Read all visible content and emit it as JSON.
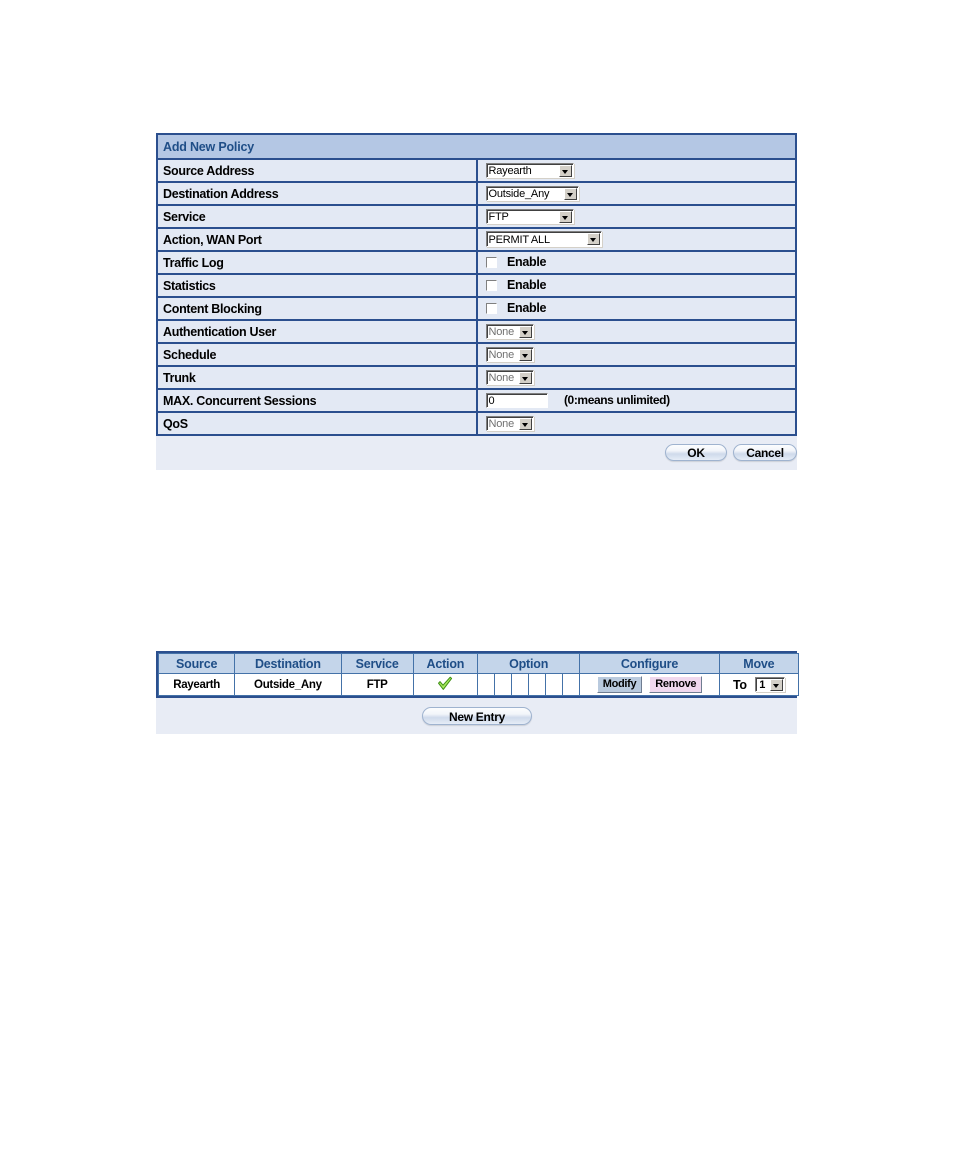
{
  "policy_form": {
    "title": "Add New Policy",
    "rows": [
      {
        "label": "Source Address",
        "type": "select",
        "value": "Rayearth",
        "width": "ws-w84",
        "dim": false
      },
      {
        "label": "Destination Address",
        "type": "select",
        "value": "Outside_Any",
        "width": "ws-w90",
        "dim": false
      },
      {
        "label": "Service",
        "type": "select",
        "value": "FTP",
        "width": "ws-w84",
        "dim": false
      },
      {
        "label": "Action, WAN Port",
        "type": "select",
        "value": "PERMIT ALL",
        "width": "ws-w110",
        "dim": false
      },
      {
        "label": "Traffic Log",
        "type": "checkbox",
        "value": "Enable",
        "checked": false
      },
      {
        "label": "Statistics",
        "type": "checkbox",
        "value": "Enable",
        "checked": false
      },
      {
        "label": "Content Blocking",
        "type": "checkbox",
        "value": "Enable",
        "checked": false
      },
      {
        "label": "Authentication User",
        "type": "select",
        "value": "None",
        "width": "ws-w46",
        "dim": true
      },
      {
        "label": "Schedule",
        "type": "select",
        "value": "None",
        "width": "ws-w46",
        "dim": true
      },
      {
        "label": "Trunk",
        "type": "select",
        "value": "None",
        "width": "ws-w46",
        "dim": true
      },
      {
        "label": "MAX. Concurrent Sessions",
        "type": "text",
        "value": "0",
        "hint": "(0:means unlimited)"
      },
      {
        "label": "QoS",
        "type": "select",
        "value": "None",
        "width": "ws-w46",
        "dim": true
      }
    ],
    "ok_label": "OK",
    "cancel_label": "Cancel"
  },
  "policy_list": {
    "headers": [
      "Source",
      "Destination",
      "Service",
      "Action",
      "Option",
      "Configure",
      "Move"
    ],
    "option_subcells": 6,
    "rows": [
      {
        "source": "Rayearth",
        "destination": "Outside_Any",
        "service": "FTP",
        "action_icon": "green-check-icon",
        "modify_label": "Modify",
        "remove_label": "Remove",
        "move_label": "To",
        "move_value": "1"
      }
    ],
    "new_entry_label": "New Entry"
  },
  "colors": {
    "panel_title_bg": "#b4c7e4",
    "panel_title_text": "#1f4e87",
    "row_bg": "#e3e9f4",
    "border": "#2b4f8e",
    "footer_bg": "#e8ecf5",
    "list_header_bg": "#c4d5ea",
    "check_green": "#9fe05a",
    "modify_bg": "#b9cade",
    "remove_bg": "#f0d8ee"
  }
}
